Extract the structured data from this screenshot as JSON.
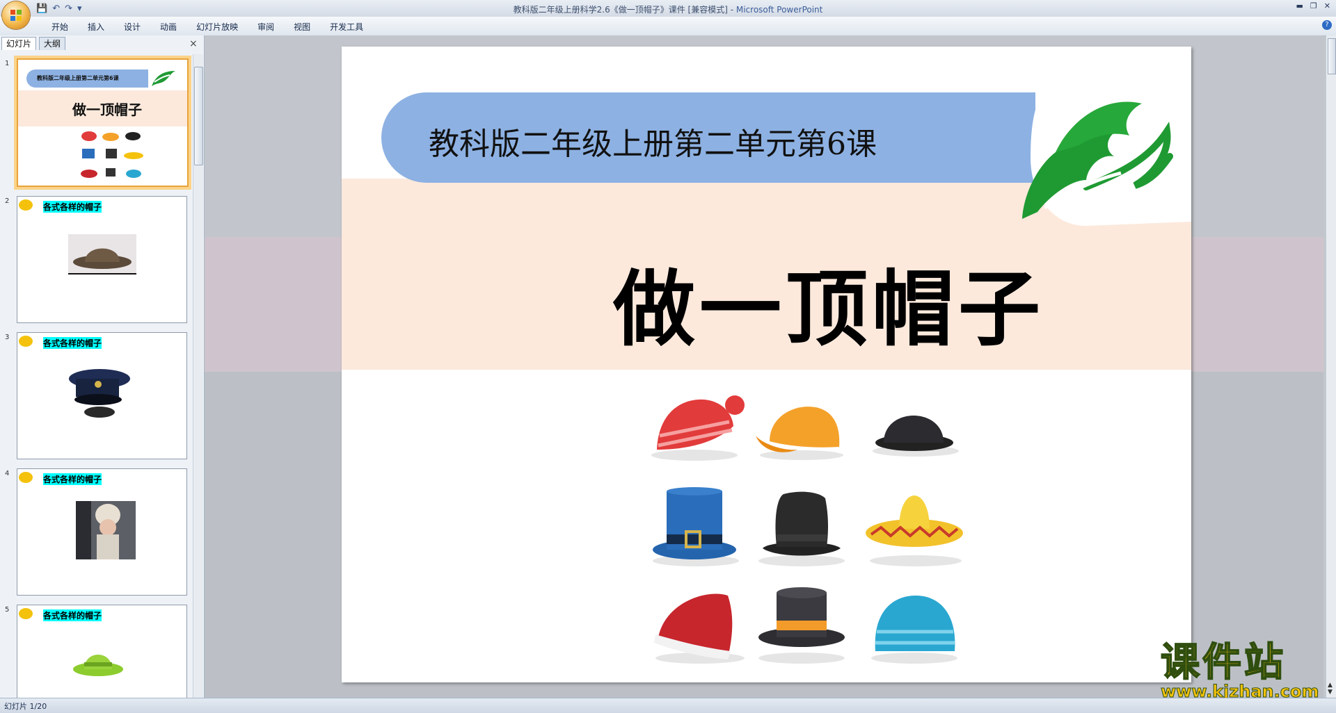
{
  "window": {
    "title": "教科版二年级上册科学2.6《做一顶帽子》课件 [兼容模式] - ",
    "app_name": "Microsoft PowerPoint"
  },
  "quick_access": [
    "save-icon",
    "undo-icon",
    "redo-icon",
    "customize-icon"
  ],
  "ribbon_tabs": [
    "开始",
    "插入",
    "设计",
    "动画",
    "幻灯片放映",
    "审阅",
    "视图",
    "开发工具"
  ],
  "left_pane": {
    "tab_slides": "幻灯片",
    "tab_outline": "大纲",
    "close": "×"
  },
  "thumbnails": [
    {
      "num": "1",
      "header": "教科版二年级上册第二单元第6课",
      "title": "做一顶帽子"
    },
    {
      "num": "2",
      "label": "各式各样的帽子"
    },
    {
      "num": "3",
      "label": "各式各样的帽子"
    },
    {
      "num": "4",
      "label": "各式各样的帽子"
    },
    {
      "num": "5",
      "label": "各式各样的帽子"
    }
  ],
  "slide": {
    "banner_text": "教科版二年级上册第二单元第6课",
    "title": "做一顶帽子",
    "colors": {
      "banner": "#8db1e2",
      "band": "#fce9dc",
      "logo_green": "#1f9a33"
    }
  },
  "status": {
    "slide_counter": "幻灯片 1/20"
  },
  "watermark": {
    "cn": "课件站",
    "url": "www.kjzhan.com"
  }
}
